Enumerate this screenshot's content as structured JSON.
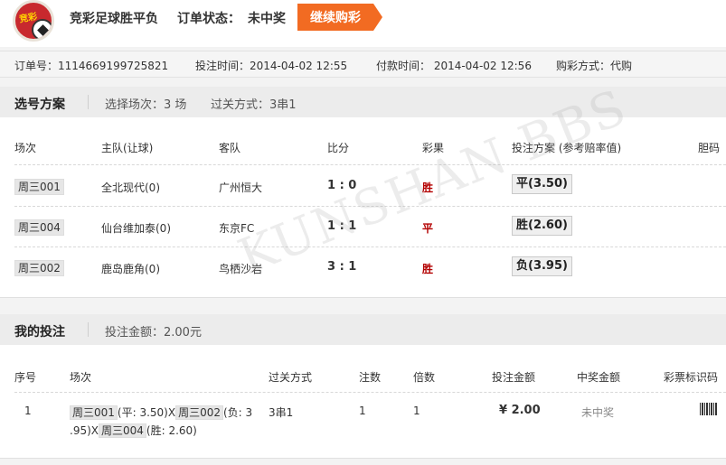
{
  "header": {
    "logo_text": "竞彩",
    "title": "竞彩足球胜平负",
    "status_label": "订单状态：",
    "status_value": "未中奖",
    "button_label": "继续购彩"
  },
  "info": {
    "order_no": "订单号：1114669199725821",
    "bet_time": "投注时间：2014-04-02 12:55",
    "pay_time": "付款时间： 2014-04-02 12:56",
    "buy_mode": "购彩方式：代购"
  },
  "selection": {
    "title": "选号方案",
    "matches_count": "选择场次：3 场",
    "pass_mode": "过关方式：3串1",
    "columns": [
      "场次",
      "主队(让球)",
      "客队",
      "比分",
      "彩果",
      "投注方案 (参考赔率值)",
      "胆码"
    ],
    "rows": [
      {
        "match": "周三001",
        "home": "全北现代(0)",
        "away": "广州恒大",
        "score": "1 : 0",
        "result": "胜",
        "pick": "平(3.50)"
      },
      {
        "match": "周三004",
        "home": "仙台维加泰(0)",
        "away": "东京FC",
        "score": "1 : 1",
        "result": "平",
        "pick": "胜(2.60)"
      },
      {
        "match": "周三002",
        "home": "鹿岛鹿角(0)",
        "away": "鸟栖沙岩",
        "score": "3 : 1",
        "result": "胜",
        "pick": "负(3.95)"
      }
    ]
  },
  "watermark": "KUNSHAN BBS",
  "bets": {
    "title": "我的投注",
    "amount": "投注金额：2.00元",
    "columns": [
      "序号",
      "场次",
      "过关方式",
      "注数",
      "倍数",
      "投注金额",
      "中奖金额",
      "彩票标识码"
    ],
    "row": {
      "index": "1",
      "m1": "周三001",
      "p1": "(平: 3.50)X",
      "m2": "周三002",
      "p2": "(负: 3",
      "p2b": ".95)X",
      "m3": "周三004",
      "p3": "(胜: 2.60)",
      "pass": "3串1",
      "count": "1",
      "multiple": "1",
      "amount": "¥ 2.00",
      "win": "未中奖"
    }
  }
}
